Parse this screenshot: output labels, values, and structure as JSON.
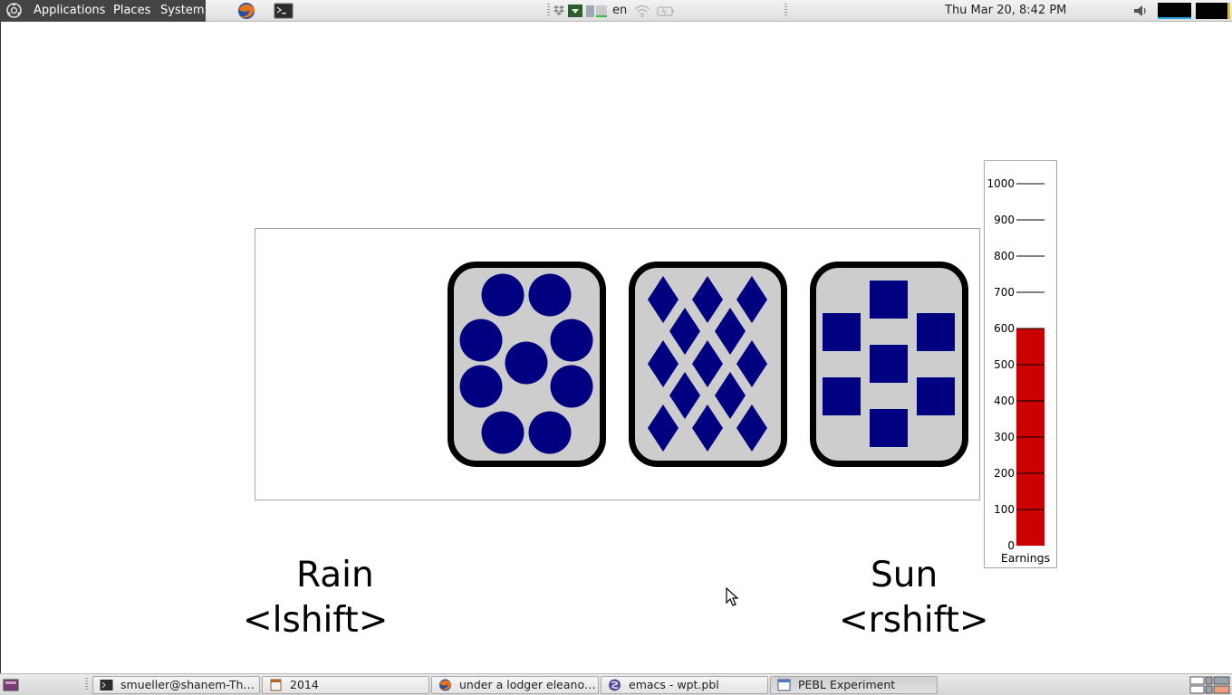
{
  "top_panel": {
    "menus": [
      "Applications",
      "Places",
      "System"
    ],
    "launchers": [
      "firefox-icon",
      "terminal-icon"
    ],
    "keyboard_layout": "en",
    "clock": "Thu Mar 20,  8:42 PM"
  },
  "experiment": {
    "cards": [
      {
        "shape": "circle",
        "count": 9,
        "fill": "#000080"
      },
      {
        "shape": "diamond",
        "count": 13,
        "fill": "#000080"
      },
      {
        "shape": "square",
        "count": 7,
        "fill": "#000080"
      }
    ],
    "card_face_color": "#cdcdcd",
    "left_choice": {
      "word": "Rain",
      "key": "<lshift>"
    },
    "right_choice": {
      "word": "Sun",
      "key": "<rshift>"
    },
    "earnings": {
      "label": "Earnings",
      "value": 600,
      "max": 1000,
      "ticks": [
        "0",
        "100",
        "200",
        "300",
        "400",
        "500",
        "600",
        "700",
        "800",
        "900",
        "1000"
      ],
      "bar_color": "#cc0000"
    }
  },
  "taskbar": {
    "tasks": [
      {
        "label": "smueller@shanem-Th…",
        "icon": "terminal-icon"
      },
      {
        "label": "2014",
        "icon": "document-icon"
      },
      {
        "label": "under a lodger eleano…",
        "icon": "firefox-icon"
      },
      {
        "label": "emacs - wpt.pbl",
        "icon": "emacs-icon"
      },
      {
        "label": "PEBL Experiment",
        "icon": "window-icon"
      }
    ]
  }
}
